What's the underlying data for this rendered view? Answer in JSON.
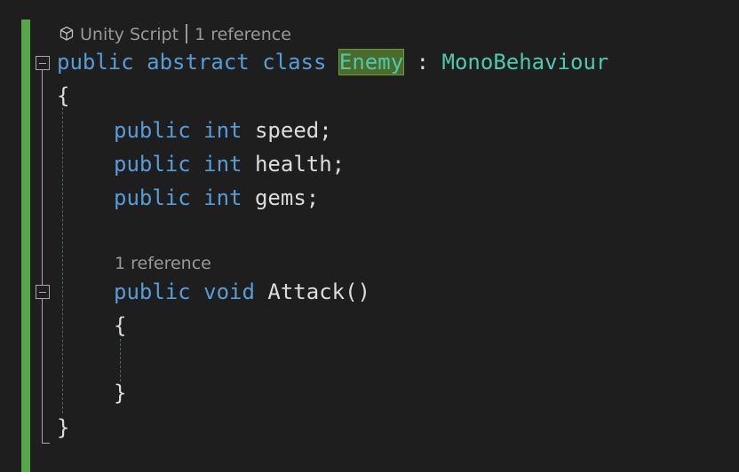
{
  "codelens_top": {
    "icon": "unity-cube-icon",
    "script_label": "Unity Script",
    "references": "1 reference"
  },
  "codelens_method": {
    "references": "1 reference"
  },
  "code": {
    "line1": {
      "kw1": "public",
      "kw2": "abstract",
      "kw3": "class",
      "class_name": "Enemy",
      "sep": ":",
      "base": "MonoBehaviour"
    },
    "line2": "{",
    "line3": {
      "kw1": "public",
      "kw2": "int",
      "rest": "speed;"
    },
    "line4": {
      "kw1": "public",
      "kw2": "int",
      "rest": "health;"
    },
    "line5": {
      "kw1": "public",
      "kw2": "int",
      "rest": "gems;"
    },
    "line6": {
      "kw1": "public",
      "kw2": "void",
      "rest": "Attack()"
    },
    "line7": "{",
    "line8": "}",
    "line9": "}"
  },
  "colors": {
    "keyword": "#569cd6",
    "type": "#4ec9b0",
    "text": "#dcdcdc",
    "change_bar": "#57a64a",
    "highlight": "#4b6b2b"
  }
}
